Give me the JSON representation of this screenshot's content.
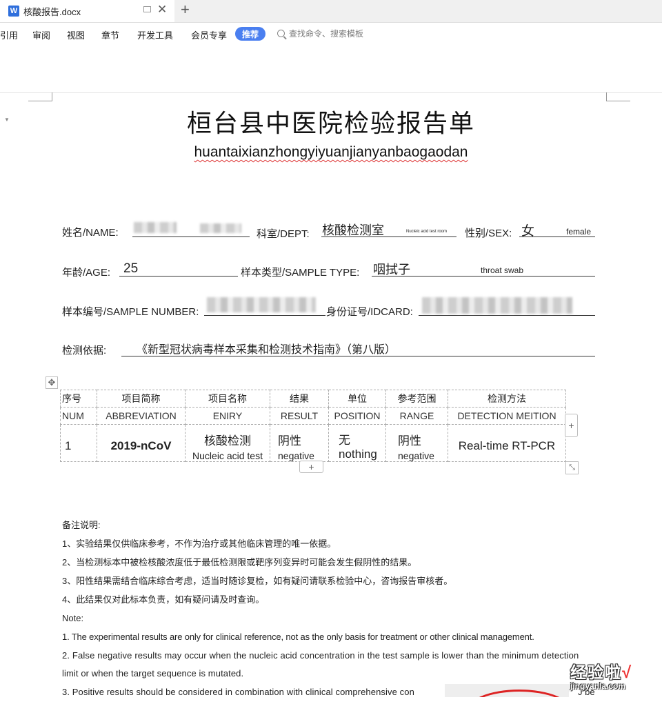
{
  "app": {
    "tab_title": "核酸报告.docx",
    "menu": [
      "引用",
      "审阅",
      "视图",
      "章节",
      "开发工具",
      "会员专享"
    ],
    "recommend": "推荐",
    "search_placeholder": "查找命令、搜索模板",
    "accent": "#4a7ff0"
  },
  "doc": {
    "title_cn": "桓台县中医院检验报告单",
    "title_py": "huantaixianzhongyiyuanjianyanbaogaodan",
    "fields": {
      "name_label": "姓名/NAME:",
      "dept_label": "科室/DEPT:",
      "dept_value": "核酸检测室",
      "dept_value_en": "Nucleic acid test room",
      "sex_label": "性别/SEX:",
      "sex_value": "女",
      "sex_value_en": "female",
      "age_label": "年龄/AGE:",
      "age_value": "25",
      "sample_type_label": "样本类型/SAMPLE TYPE:",
      "sample_type_value": "咽拭子",
      "sample_type_value_en": "throat swab",
      "sample_no_label": "样本编号/SAMPLE NUMBER:",
      "idcard_label": "身份证号/IDCARD:",
      "basis_label": "检测依据:",
      "basis_value": "《新型冠状病毒样本采集和检测技术指南》（第八版）"
    },
    "table": {
      "headers_cn": [
        "序号",
        "项目简称",
        "项目名称",
        "结果",
        "单位",
        "参考范围",
        "检测方法"
      ],
      "headers_en": [
        "NUM",
        "ABBREVIATION",
        "ENIRY",
        "RESULT",
        "POSITION",
        "RANGE",
        "DETECTION MEITION"
      ],
      "row": {
        "num": "1",
        "abbr": "2019-nCoV",
        "name_cn": "核酸检测",
        "name_en": "Nucleic acid test",
        "result_cn": "阴性",
        "result_en": "negative",
        "unit_cn": "无",
        "unit_en": "nothing",
        "range_cn": "阴性",
        "range_en": "negative",
        "method": "Real-time RT-PCR"
      }
    },
    "notes_title": "备注说明:",
    "notes_cn": [
      "1、实验结果仅供临床参考，不作为治疗或其他临床管理的唯一依据。",
      "2、当检测标本中被检核酸浓度低于最低检测限或靶序列变异时可能会发生假阴性的结果。",
      "3、阳性结果需结合临床综合考虑，适当时随诊复检，如有疑问请联系检验中心，咨询报告审核者。",
      "4、此结果仅对此标本负责，如有疑问请及时查询。"
    ],
    "note_en_title": "Note:",
    "notes_en": [
      "1. The experimental results are only for clinical reference, not as the only basis for treatment or other clinical management.",
      "2. False negative results may occur when the nucleic acid concentration in the test sample is lower than the minimum detection",
      "limit or when the target sequence is mutated.",
      "3.  Positive  results  should  be  considered  in  combination  with  clinical  comprehensive  con"
    ],
    "note_en_tail": "J be"
  },
  "watermark": {
    "cn": "经验啦",
    "check": "√",
    "py": "jingyanla.com"
  }
}
